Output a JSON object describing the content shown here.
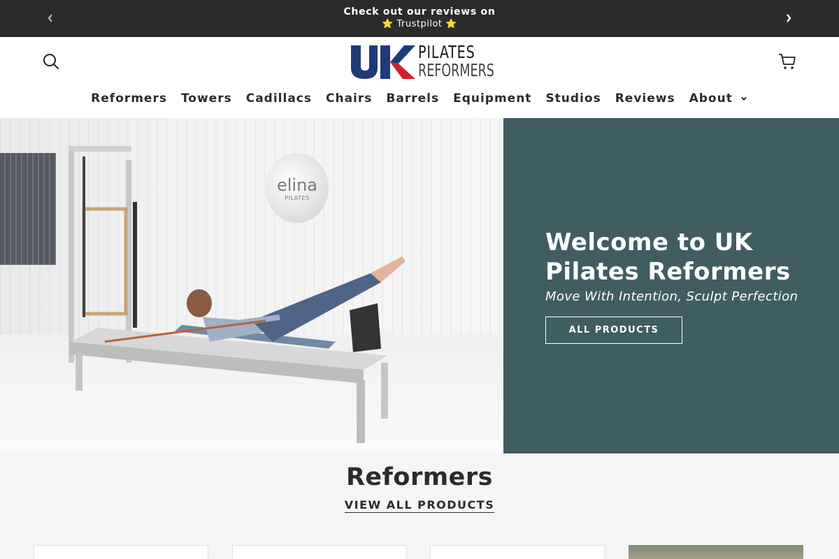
{
  "announcement": {
    "line1": "Check out our reviews on",
    "line2": "⭐ Trustpilot ⭐",
    "prev_icon": "chevron-left-icon",
    "next_icon": "chevron-right-icon"
  },
  "header": {
    "search_icon": "search-icon",
    "cart_icon": "cart-icon",
    "logo": {
      "mark": "UK",
      "line1": "PILATES",
      "line2": "REFORMERS",
      "colors": {
        "blue": "#1f3a7a",
        "red": "#d2202f"
      }
    }
  },
  "nav": {
    "items": [
      {
        "label": "Reformers"
      },
      {
        "label": "Towers"
      },
      {
        "label": "Cadillacs"
      },
      {
        "label": "Chairs"
      },
      {
        "label": "Barrels"
      },
      {
        "label": "Equipment"
      },
      {
        "label": "Studios"
      },
      {
        "label": "Reviews"
      },
      {
        "label": "About",
        "has_dropdown": true
      }
    ]
  },
  "hero": {
    "image_badge": {
      "brand": "elina",
      "sub": "PILATES"
    },
    "title": "Welcome to UK Pilates Reformers",
    "subtitle": "Move With Intention, Sculpt Perfection",
    "cta": "ALL PRODUCTS",
    "panel_color": "#405d62"
  },
  "section": {
    "heading": "Reformers",
    "link": "VIEW ALL PRODUCTS",
    "cards_count": 4
  }
}
